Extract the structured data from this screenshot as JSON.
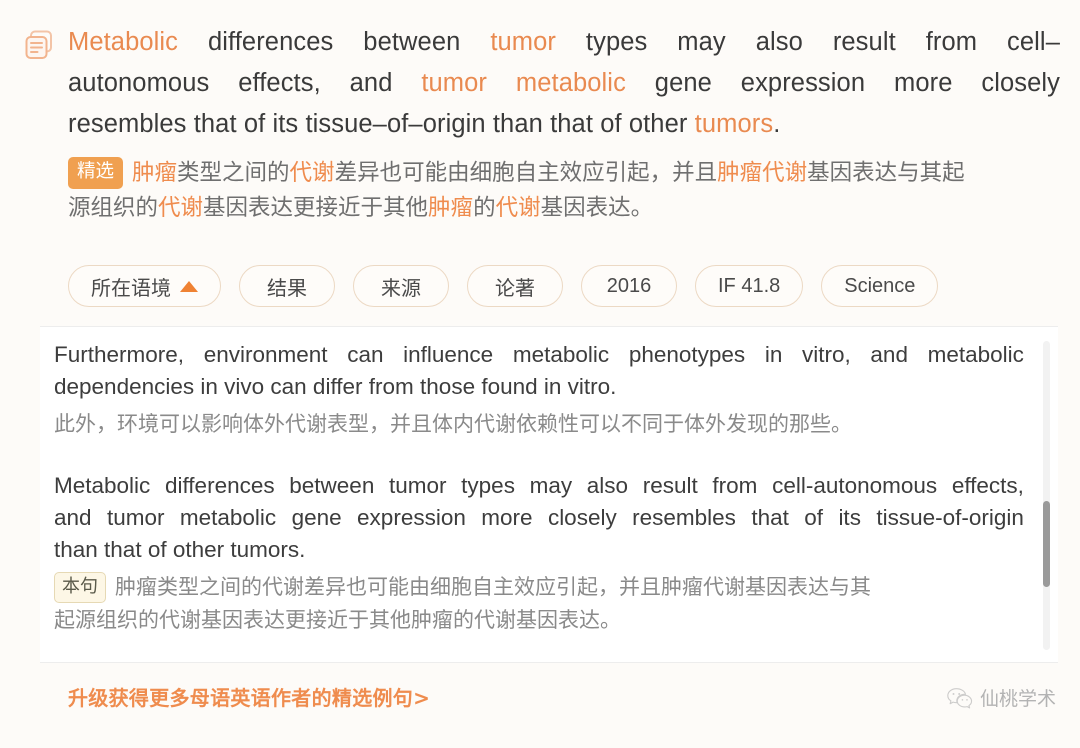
{
  "colors": {
    "page_bg": "#fdfbf8",
    "accent_orange": "#ef8c4e",
    "badge_orange": "#f0a050",
    "panel_bg": "#ffffff",
    "text_dark": "#3a3a3a",
    "text_zh": "#6f6f6f",
    "watermark_gray": "#b3b3b3",
    "pill_border": "#ecd9c4",
    "this_badge_bg": "#fdf7e6",
    "this_badge_border": "#e6d9b4"
  },
  "featured": {
    "icon": "documents-stack-icon",
    "english": {
      "full_text": "Metabolic differences between tumor types may also result from cell-autonomous effects, and tumor metabolic gene expression more closely resembles that of its tissue-of-origin than that of other tumors.",
      "lines": [
        [
          {
            "t": "Metabolic",
            "hl": true
          },
          {
            "t": " differences between ",
            "hl": false
          },
          {
            "t": "tumor",
            "hl": true
          },
          {
            "t": " types may also result from cell–",
            "hl": false
          }
        ],
        [
          {
            "t": "autonomous effects, and ",
            "hl": false
          },
          {
            "t": "tumor metabolic",
            "hl": true
          },
          {
            "t": " gene expression more closely",
            "hl": false
          }
        ],
        [
          {
            "t": "resembles that of its tissue–of–origin than that of other ",
            "hl": false
          },
          {
            "t": "tumors",
            "hl": true
          },
          {
            "t": ".",
            "hl": false
          }
        ]
      ],
      "justified_words": {
        "line1": [
          "Metabolic",
          "differences",
          "between",
          "tumor",
          "types",
          "may",
          "also",
          "result",
          "from",
          "cell–"
        ],
        "line2": [
          "autonomous",
          "effects,",
          "and",
          "tumor",
          "metabolic",
          "gene",
          "expression",
          "more",
          "closely"
        ]
      }
    },
    "badge_label": "精选",
    "chinese": {
      "full_text": "肿瘤类型之间的代谢差异也可能由细胞自主效应引起，并且肿瘤代谢基因表达与其起源组织的代谢基因表达更接近于其他肿瘤的代谢基因表达。",
      "lines": [
        [
          {
            "t": "肿瘤",
            "hl": true
          },
          {
            "t": "类型之间的",
            "hl": false
          },
          {
            "t": "代谢",
            "hl": true
          },
          {
            "t": "差异也可能由细胞自主效应引起，并且",
            "hl": false
          },
          {
            "t": "肿瘤代谢",
            "hl": true
          },
          {
            "t": "基因表达与其起",
            "hl": false
          }
        ],
        [
          {
            "t": "源组织的",
            "hl": false
          },
          {
            "t": "代谢",
            "hl": true
          },
          {
            "t": "基因表达更接近于其他",
            "hl": false
          },
          {
            "t": "肿瘤",
            "hl": true
          },
          {
            "t": "的",
            "hl": false
          },
          {
            "t": "代谢",
            "hl": true
          },
          {
            "t": "基因表达。",
            "hl": false
          }
        ]
      ]
    }
  },
  "tags": [
    {
      "label": "所在语境",
      "icon": "triangle-up-icon",
      "active": true,
      "latin": false
    },
    {
      "label": "结果",
      "icon": null,
      "active": false,
      "latin": false
    },
    {
      "label": "来源",
      "icon": null,
      "active": false,
      "latin": false
    },
    {
      "label": "论著",
      "icon": null,
      "active": false,
      "latin": false
    },
    {
      "label": "2016",
      "icon": null,
      "active": false,
      "latin": true
    },
    {
      "label": "IF 41.8",
      "icon": null,
      "active": false,
      "latin": true
    },
    {
      "label": "Science",
      "icon": null,
      "active": false,
      "latin": true
    }
  ],
  "context_panel": {
    "paragraph1": {
      "english_full": "Furthermore, environment can influence metabolic phenotypes in vitro, and metabolic dependencies in vivo can differ from those found in vitro.",
      "english_lines": [
        "Furthermore, environment can influence metabolic phenotypes in vitro, and metabolic",
        "dependencies in vivo can differ from those found in vitro."
      ],
      "english_line1_words": [
        "Furthermore,",
        "environment",
        "can",
        "influence",
        "metabolic",
        "phenotypes",
        "in",
        "vitro,",
        "and",
        "metabolic"
      ],
      "chinese_full": "此外，环境可以影响体外代谢表型，并且体内代谢依赖性可以不同于体外发现的那些。",
      "chinese_lines": [
        "此外，环境可以影响体外代谢表型，并且体内代谢依赖性可以不同于体外发现的那些。"
      ]
    },
    "paragraph2": {
      "english_full": "Metabolic differences between tumor types may also result from cell-autonomous effects, and tumor metabolic gene expression more closely resembles that of its tissue-of-origin than that of other tumors.",
      "english_lines": [
        "Metabolic differences between tumor types may also result from cell-autonomous effects,",
        "and tumor metabolic gene expression more closely resembles that of its tissue-of-origin",
        "than that of other tumors."
      ],
      "english_line1_words": [
        "Metabolic",
        "differences",
        "between",
        "tumor",
        "types",
        "may",
        "also",
        "result",
        "from",
        "cell-autonomous",
        "effects,"
      ],
      "english_line2_words": [
        "and",
        "tumor",
        "metabolic",
        "gene",
        "expression",
        "more",
        "closely",
        "resembles",
        "that",
        "of",
        "its",
        "tissue-of-origin"
      ],
      "badge_label": "本句",
      "chinese_full": "肿瘤类型之间的代谢差异也可能由细胞自主效应引起，并且肿瘤代谢基因表达与其起源组织的代谢基因表达更接近于其他肿瘤的代谢基因表达。",
      "chinese_lines": [
        "肿瘤类型之间的代谢差异也可能由细胞自主效应引起，并且肿瘤代谢基因表达与其",
        "起源组织的代谢基因表达更接近于其他肿瘤的代谢基因表达。"
      ]
    },
    "scrollbar": {
      "name": "vertical-scrollbar",
      "thumb_position_percent": 52
    }
  },
  "footer": {
    "upsell_text": "升级获得更多母语英语作者的精选例句>",
    "watermark_text": "仙桃学术",
    "watermark_icon": "wechat-icon"
  }
}
